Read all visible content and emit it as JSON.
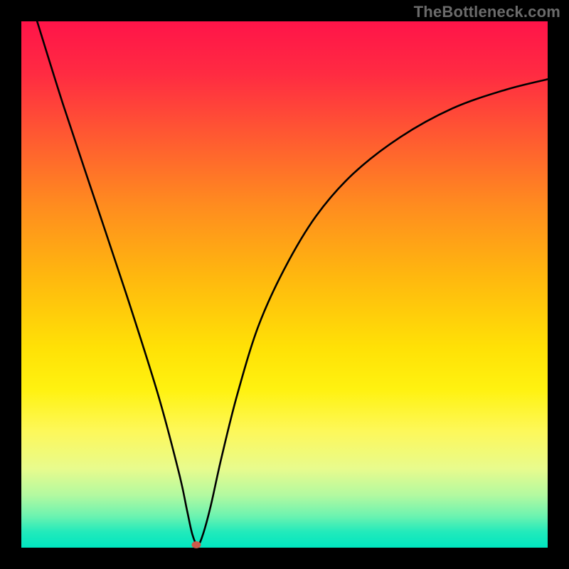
{
  "watermark": "TheBottleneck.com",
  "chart_data": {
    "type": "line",
    "title": "",
    "xlabel": "",
    "ylabel": "",
    "xlim": [
      0,
      100
    ],
    "ylim": [
      0,
      100
    ],
    "grid": false,
    "legend": false,
    "series": [
      {
        "name": "curve",
        "x": [
          3,
          8,
          14,
          20,
          26,
          30,
          31.5,
          32.5,
          33.5,
          34.5,
          36,
          38,
          41,
          45,
          50,
          56,
          63,
          72,
          82,
          92,
          100
        ],
        "y": [
          100,
          84,
          66,
          48,
          29,
          14,
          7,
          2.5,
          0.5,
          2.5,
          8,
          17,
          29,
          42,
          53,
          63,
          71,
          78,
          83.5,
          87,
          89
        ]
      }
    ],
    "marker": {
      "x": 33.2,
      "y": 0.5,
      "color": "#cc5a4a"
    },
    "background_gradient": {
      "top": "#ff1449",
      "mid": "#ffe106",
      "bottom": "#00e6c0"
    }
  }
}
